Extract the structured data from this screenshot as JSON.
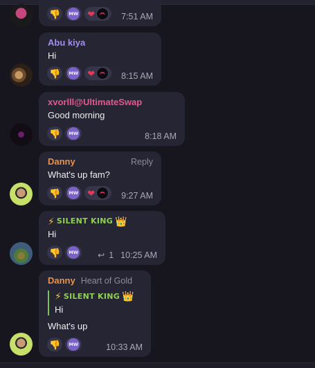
{
  "colors": {
    "background": "#17161e",
    "bubble": "#262533",
    "name_purple": "#a48bf2",
    "name_pink": "#e8568f",
    "name_orange": "#e9924a",
    "badge_green": "#8fd14f"
  },
  "messages": [
    {
      "id": "m0",
      "time": "7:51 AM",
      "reactions": [
        "thumbs-down",
        "mw",
        "heart",
        "cat"
      ]
    },
    {
      "id": "m1",
      "author": "Abu kiya",
      "text": "Hi",
      "time": "8:15 AM",
      "reactions": [
        "thumbs-down",
        "mw",
        "heart",
        "cat"
      ]
    },
    {
      "id": "m2",
      "author": "xvorlll@UltimateSwap",
      "text": "Good morning",
      "time": "8:18 AM",
      "reactions": [
        "thumbs-down",
        "mw"
      ]
    },
    {
      "id": "m3",
      "author": "Danny",
      "reply_label": "Reply",
      "text": "What's up fam?",
      "time": "9:27 AM",
      "reactions": [
        "thumbs-down",
        "mw",
        "heart",
        "cat"
      ]
    },
    {
      "id": "m4",
      "author": "SILENT KING",
      "text": "Hi",
      "reply_count": "1",
      "time": "10:25 AM",
      "reactions": [
        "thumbs-down",
        "mw"
      ]
    },
    {
      "id": "m5",
      "author": "Danny",
      "author_title": "Heart of Gold",
      "quote_author": "SILENT KING",
      "quote_text": "Hi",
      "text": "What's up",
      "time": "10:33 AM",
      "reactions": [
        "thumbs-down",
        "mw"
      ]
    }
  ],
  "icons": {
    "thumbs_down": "👎",
    "heart": "❤",
    "bolt": "⚡",
    "crown": "👑",
    "mw_label": "MW",
    "reply_arrow": "↩"
  }
}
